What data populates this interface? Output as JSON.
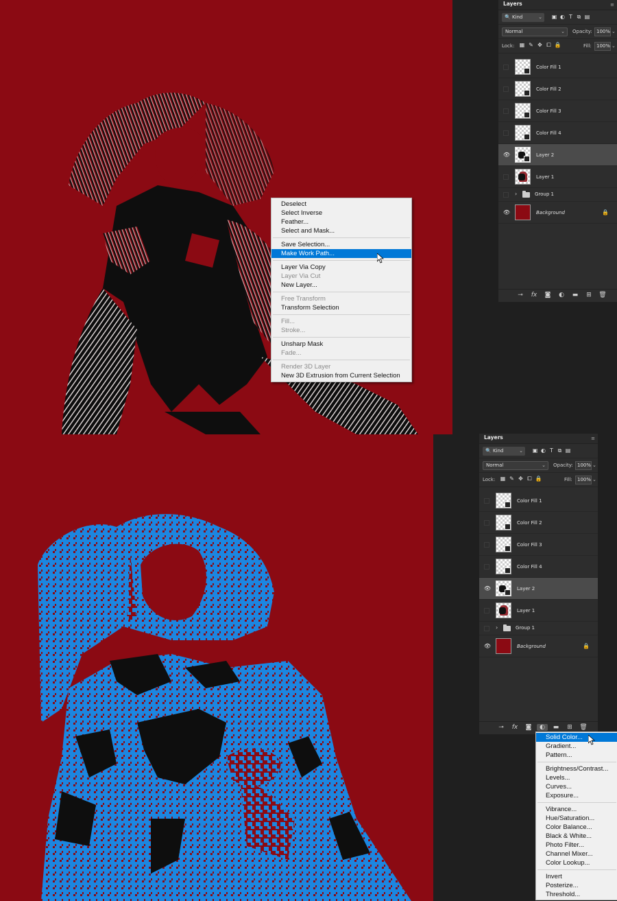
{
  "colors": {
    "canvas_red": "#8b0a13",
    "selection_blue": "#1c86e0",
    "menu_highlight": "#0078d7"
  },
  "top": {
    "layers_panel": {
      "tab": "Layers",
      "kind": "Kind",
      "blend_mode": "Normal",
      "opacity_label": "Opacity:",
      "opacity_value": "100%",
      "lock_label": "Lock:",
      "fill_label": "Fill:",
      "fill_value": "100%",
      "layers": [
        "Color Fill 1",
        "Color Fill 2",
        "Color Fill 3",
        "Color Fill 4",
        "Layer 2",
        "Layer 1",
        "Group 1",
        "Background"
      ]
    },
    "context_menu": {
      "items": [
        "Deselect",
        "Select Inverse",
        "Feather...",
        "Select and Mask...",
        "Save Selection...",
        "Make Work Path...",
        "Layer Via Copy",
        "Layer Via Cut",
        "New Layer...",
        "Free Transform",
        "Transform Selection",
        "Fill...",
        "Stroke...",
        "Unsharp Mask",
        "Fade...",
        "Render 3D Layer",
        "New 3D Extrusion from Current Selection"
      ]
    }
  },
  "bottom": {
    "layers_panel": {
      "tab": "Layers",
      "kind": "Kind",
      "blend_mode": "Normal",
      "opacity_label": "Opacity:",
      "opacity_value": "100%",
      "lock_label": "Lock:",
      "fill_label": "Fill:",
      "fill_value": "100%",
      "layers": [
        "Color Fill 1",
        "Color Fill 2",
        "Color Fill 3",
        "Color Fill 4",
        "Layer 2",
        "Layer 1",
        "Group 1",
        "Background"
      ]
    },
    "adjustment_menu": {
      "items": [
        "Solid Color...",
        "Gradient...",
        "Pattern...",
        "Brightness/Contrast...",
        "Levels...",
        "Curves...",
        "Exposure...",
        "Vibrance...",
        "Hue/Saturation...",
        "Color Balance...",
        "Black & White...",
        "Photo Filter...",
        "Channel Mixer...",
        "Color Lookup...",
        "Invert",
        "Posterize...",
        "Threshold..."
      ]
    }
  }
}
